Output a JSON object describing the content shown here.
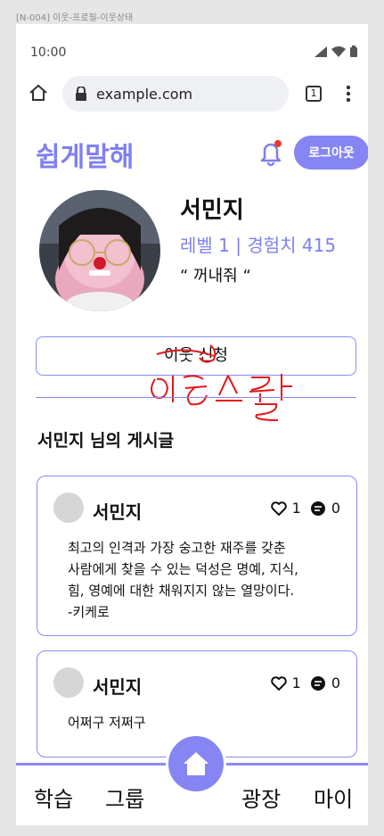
{
  "frame_label": "[N-004] 이웃-프로필-이웃상태",
  "status_bar": {
    "time": "10:00"
  },
  "browser": {
    "url": "example.com",
    "tab_count": "1"
  },
  "header": {
    "app_title": "쉽게말해",
    "logout_label": "로그아웃",
    "accent_color": "#7f7ff1",
    "notification_dot_color": "#e53935"
  },
  "profile": {
    "name": "서민지",
    "meta": "레벨 1 | 경험치 415",
    "quote": "“ 꺼내줘 “"
  },
  "request_button_label": "이웃 신청",
  "annotation_text": "이웃 수락",
  "posts_heading": "서민지 님의 게시글",
  "posts": [
    {
      "author": "서민지",
      "likes": "1",
      "comments": "0",
      "body": "최고의 인격과 가장 숭고한 재주를 갖춘\n사람에게 찾을 수 있는 덕성은 명예, 지식,\n힘, 영예에 대한 채워지지 않는 열망이다.\n-키케로"
    },
    {
      "author": "서민지",
      "likes": "1",
      "comments": "0",
      "body": "어쩌구 저쩌구"
    }
  ],
  "bottom_nav": {
    "learn": "학습",
    "group": "그룹",
    "plaza": "광장",
    "my": "마이"
  }
}
